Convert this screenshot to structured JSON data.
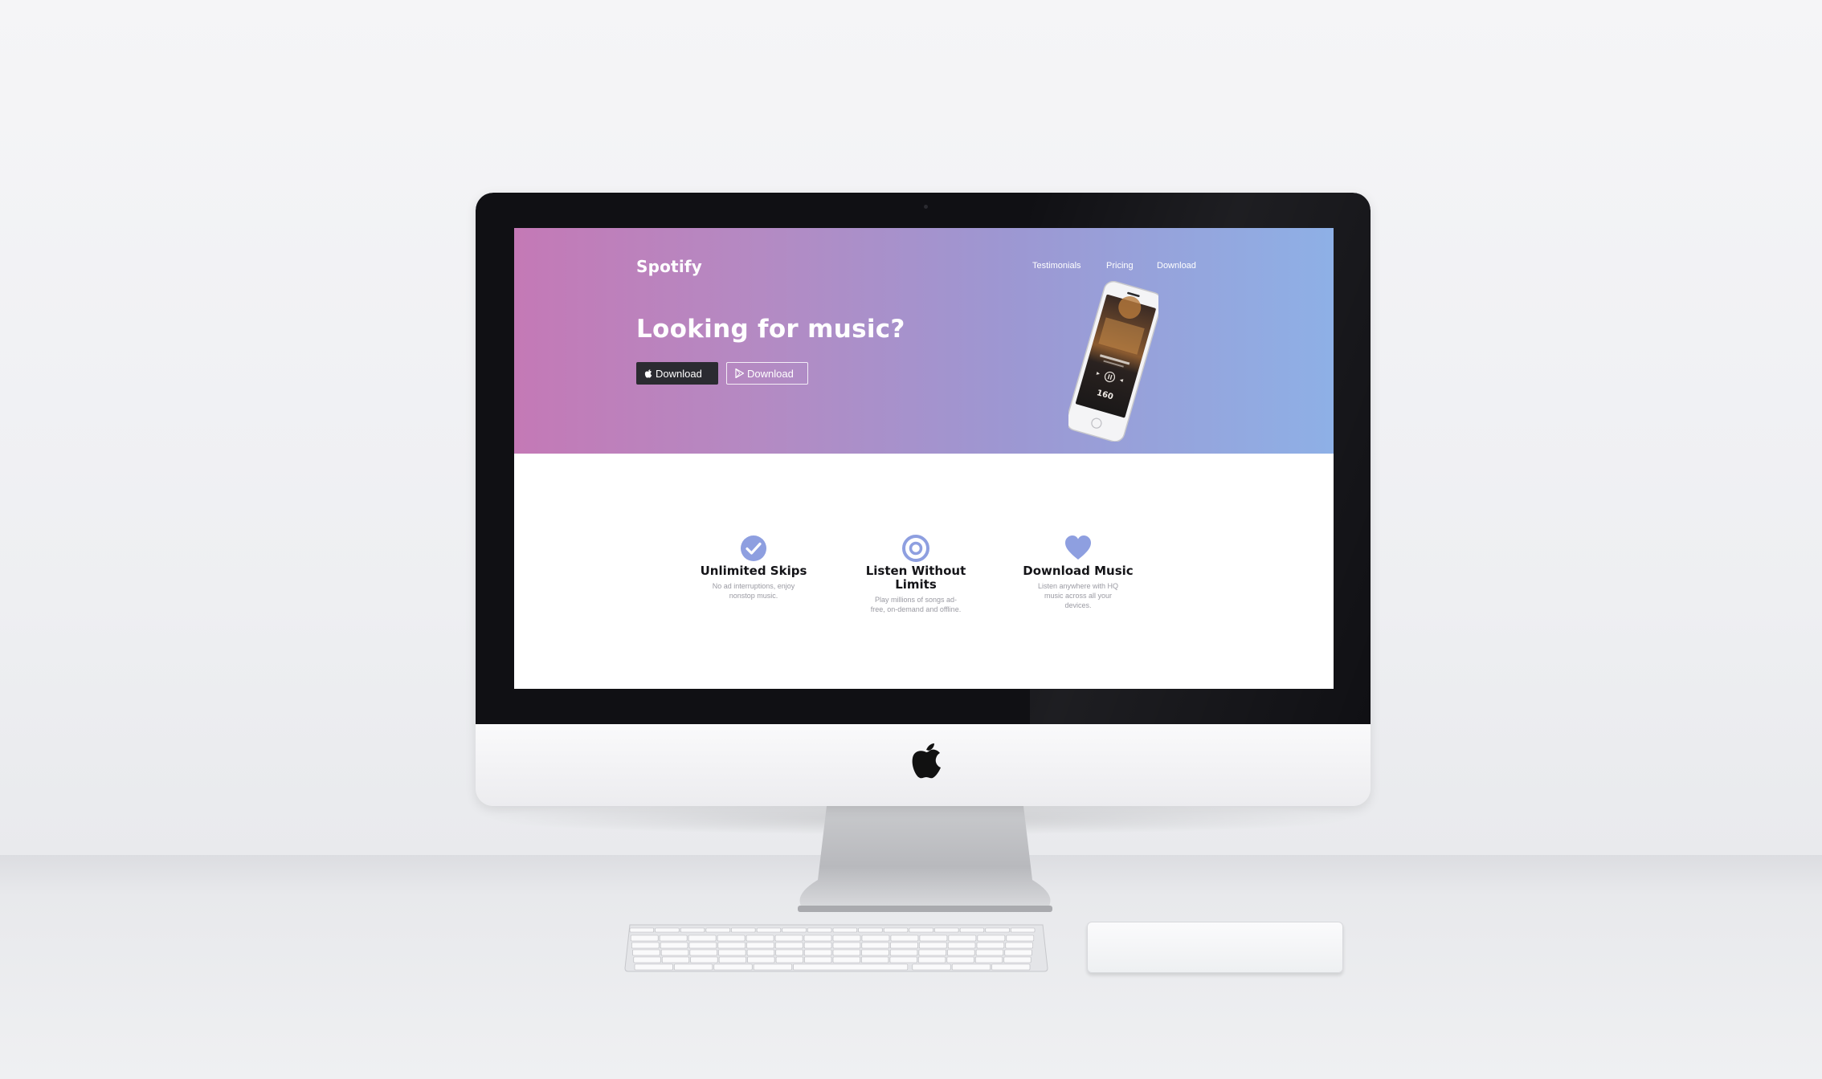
{
  "site": {
    "brand": "Spotify",
    "nav": [
      "Testimonials",
      "Pricing",
      "Download"
    ],
    "hero": {
      "headline": "Looking for music?",
      "buttons": [
        {
          "label": "Download",
          "icon": "apple-icon",
          "style": "dark"
        },
        {
          "label": "Download",
          "icon": "play-store-icon",
          "style": "outline"
        }
      ],
      "phone_counter": "160"
    },
    "features": [
      {
        "icon": "check-circle-icon",
        "title": "Unlimited Skips",
        "description": "No ad interruptions, enjoy nonstop music."
      },
      {
        "icon": "target-icon",
        "title": "Listen Without Limits",
        "description": "Play millions of songs ad-free, on-demand and offline."
      },
      {
        "icon": "heart-icon",
        "title": "Download Music",
        "description": "Listen anywhere with HQ music across all your devices."
      }
    ]
  },
  "colors": {
    "hero_left": "#c479b6",
    "hero_right": "#8eb0e6",
    "feature_icon": "#8e9fe0",
    "dark_button": "#2b2b31"
  }
}
